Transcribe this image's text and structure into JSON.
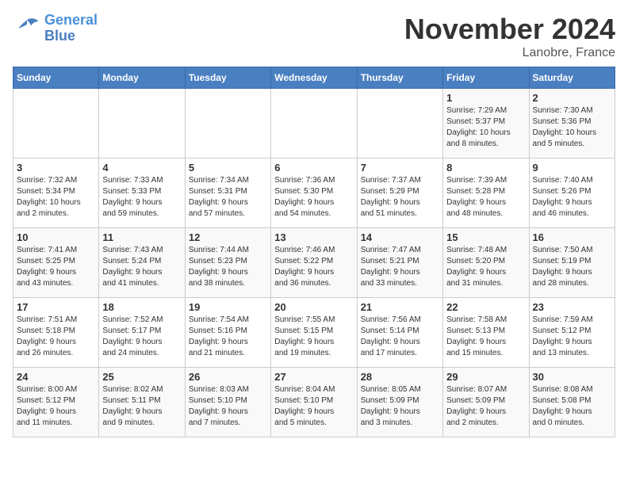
{
  "logo": {
    "line1": "General",
    "line2": "Blue"
  },
  "title": "November 2024",
  "location": "Lanobre, France",
  "weekdays": [
    "Sunday",
    "Monday",
    "Tuesday",
    "Wednesday",
    "Thursday",
    "Friday",
    "Saturday"
  ],
  "weeks": [
    [
      {
        "day": "",
        "info": ""
      },
      {
        "day": "",
        "info": ""
      },
      {
        "day": "",
        "info": ""
      },
      {
        "day": "",
        "info": ""
      },
      {
        "day": "",
        "info": ""
      },
      {
        "day": "1",
        "info": "Sunrise: 7:29 AM\nSunset: 5:37 PM\nDaylight: 10 hours\nand 8 minutes."
      },
      {
        "day": "2",
        "info": "Sunrise: 7:30 AM\nSunset: 5:36 PM\nDaylight: 10 hours\nand 5 minutes."
      }
    ],
    [
      {
        "day": "3",
        "info": "Sunrise: 7:32 AM\nSunset: 5:34 PM\nDaylight: 10 hours\nand 2 minutes."
      },
      {
        "day": "4",
        "info": "Sunrise: 7:33 AM\nSunset: 5:33 PM\nDaylight: 9 hours\nand 59 minutes."
      },
      {
        "day": "5",
        "info": "Sunrise: 7:34 AM\nSunset: 5:31 PM\nDaylight: 9 hours\nand 57 minutes."
      },
      {
        "day": "6",
        "info": "Sunrise: 7:36 AM\nSunset: 5:30 PM\nDaylight: 9 hours\nand 54 minutes."
      },
      {
        "day": "7",
        "info": "Sunrise: 7:37 AM\nSunset: 5:29 PM\nDaylight: 9 hours\nand 51 minutes."
      },
      {
        "day": "8",
        "info": "Sunrise: 7:39 AM\nSunset: 5:28 PM\nDaylight: 9 hours\nand 48 minutes."
      },
      {
        "day": "9",
        "info": "Sunrise: 7:40 AM\nSunset: 5:26 PM\nDaylight: 9 hours\nand 46 minutes."
      }
    ],
    [
      {
        "day": "10",
        "info": "Sunrise: 7:41 AM\nSunset: 5:25 PM\nDaylight: 9 hours\nand 43 minutes."
      },
      {
        "day": "11",
        "info": "Sunrise: 7:43 AM\nSunset: 5:24 PM\nDaylight: 9 hours\nand 41 minutes."
      },
      {
        "day": "12",
        "info": "Sunrise: 7:44 AM\nSunset: 5:23 PM\nDaylight: 9 hours\nand 38 minutes."
      },
      {
        "day": "13",
        "info": "Sunrise: 7:46 AM\nSunset: 5:22 PM\nDaylight: 9 hours\nand 36 minutes."
      },
      {
        "day": "14",
        "info": "Sunrise: 7:47 AM\nSunset: 5:21 PM\nDaylight: 9 hours\nand 33 minutes."
      },
      {
        "day": "15",
        "info": "Sunrise: 7:48 AM\nSunset: 5:20 PM\nDaylight: 9 hours\nand 31 minutes."
      },
      {
        "day": "16",
        "info": "Sunrise: 7:50 AM\nSunset: 5:19 PM\nDaylight: 9 hours\nand 28 minutes."
      }
    ],
    [
      {
        "day": "17",
        "info": "Sunrise: 7:51 AM\nSunset: 5:18 PM\nDaylight: 9 hours\nand 26 minutes."
      },
      {
        "day": "18",
        "info": "Sunrise: 7:52 AM\nSunset: 5:17 PM\nDaylight: 9 hours\nand 24 minutes."
      },
      {
        "day": "19",
        "info": "Sunrise: 7:54 AM\nSunset: 5:16 PM\nDaylight: 9 hours\nand 21 minutes."
      },
      {
        "day": "20",
        "info": "Sunrise: 7:55 AM\nSunset: 5:15 PM\nDaylight: 9 hours\nand 19 minutes."
      },
      {
        "day": "21",
        "info": "Sunrise: 7:56 AM\nSunset: 5:14 PM\nDaylight: 9 hours\nand 17 minutes."
      },
      {
        "day": "22",
        "info": "Sunrise: 7:58 AM\nSunset: 5:13 PM\nDaylight: 9 hours\nand 15 minutes."
      },
      {
        "day": "23",
        "info": "Sunrise: 7:59 AM\nSunset: 5:12 PM\nDaylight: 9 hours\nand 13 minutes."
      }
    ],
    [
      {
        "day": "24",
        "info": "Sunrise: 8:00 AM\nSunset: 5:12 PM\nDaylight: 9 hours\nand 11 minutes."
      },
      {
        "day": "25",
        "info": "Sunrise: 8:02 AM\nSunset: 5:11 PM\nDaylight: 9 hours\nand 9 minutes."
      },
      {
        "day": "26",
        "info": "Sunrise: 8:03 AM\nSunset: 5:10 PM\nDaylight: 9 hours\nand 7 minutes."
      },
      {
        "day": "27",
        "info": "Sunrise: 8:04 AM\nSunset: 5:10 PM\nDaylight: 9 hours\nand 5 minutes."
      },
      {
        "day": "28",
        "info": "Sunrise: 8:05 AM\nSunset: 5:09 PM\nDaylight: 9 hours\nand 3 minutes."
      },
      {
        "day": "29",
        "info": "Sunrise: 8:07 AM\nSunset: 5:09 PM\nDaylight: 9 hours\nand 2 minutes."
      },
      {
        "day": "30",
        "info": "Sunrise: 8:08 AM\nSunset: 5:08 PM\nDaylight: 9 hours\nand 0 minutes."
      }
    ]
  ]
}
